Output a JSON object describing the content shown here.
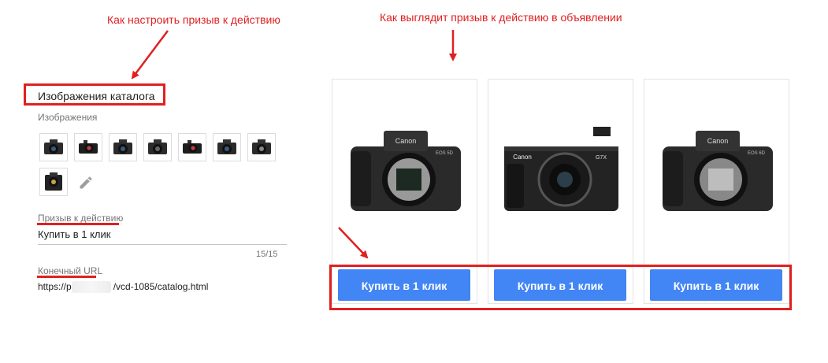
{
  "annotations": {
    "left_caption": "Как настроить призыв к действию",
    "right_caption": "Как выглядит призыв к действию в объявлении"
  },
  "settings_panel": {
    "title": "Изображения каталога",
    "images_label": "Изображения",
    "thumbnails": [
      "camera-thumb-1",
      "camera-thumb-2",
      "camera-thumb-3",
      "camera-thumb-4",
      "camera-thumb-5",
      "camera-thumb-6",
      "camera-thumb-7",
      "camera-thumb-8"
    ],
    "cta_label": "Призыв к действию",
    "cta_value": "Купить в 1 клик",
    "cta_counter": "15/15",
    "url_label": "Конечный URL",
    "url_prefix": "https://p",
    "url_suffix": "/vcd-1085/catalog.html"
  },
  "ad_preview": {
    "cards": [
      {
        "brand": "Canon",
        "model": "EOS 5D",
        "button": "Купить в 1 клик"
      },
      {
        "brand": "Canon",
        "model": "G7X",
        "button": "Купить в 1 клик"
      },
      {
        "brand": "Canon",
        "model": "EOS 6D",
        "button": "Купить в 1 клик"
      }
    ]
  },
  "colors": {
    "annotation_red": "#e02020",
    "button_blue": "#4285f4"
  }
}
